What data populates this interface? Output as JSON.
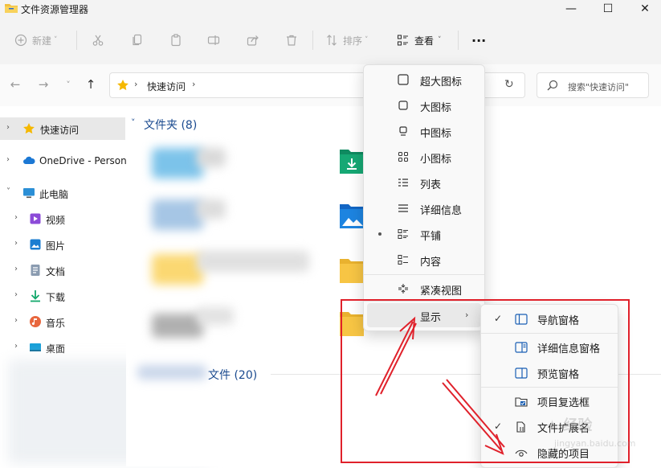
{
  "window": {
    "title": "文件资源管理器",
    "min_glyph": "—",
    "max_glyph": "☐",
    "close_glyph": "✕"
  },
  "toolbar": {
    "new_label": "新建",
    "sort_label": "排序",
    "view_label": "查看",
    "more_glyph": "···"
  },
  "nav": {
    "back_glyph": "←",
    "forward_glyph": "→",
    "recent_glyph": "˅",
    "up_glyph": "↑",
    "breadcrumb": "快速访问",
    "sep_glyph": "›",
    "refresh_glyph": "↻",
    "search_placeholder": "搜索\"快速访问\""
  },
  "sidebar": {
    "items": [
      {
        "label": "快速访问",
        "icon": "star-icon"
      },
      {
        "label": "OneDrive - Person",
        "icon": "cloud-icon"
      },
      {
        "label": "此电脑",
        "icon": "computer-icon"
      },
      {
        "label": "视频",
        "icon": "video-icon"
      },
      {
        "label": "图片",
        "icon": "picture-icon"
      },
      {
        "label": "文档",
        "icon": "document-icon"
      },
      {
        "label": "下载",
        "icon": "download-icon"
      },
      {
        "label": "音乐",
        "icon": "music-icon"
      },
      {
        "label": "桌面",
        "icon": "desktop-icon"
      }
    ],
    "chev_right": "›",
    "chev_down": "˅"
  },
  "content": {
    "folders_header": "文件夹 (8)",
    "files_header": "文件 (20)",
    "chev_down": "˅"
  },
  "view_menu": {
    "items": [
      {
        "label": "超大图标",
        "icon": "extra-large-icons-icon"
      },
      {
        "label": "大图标",
        "icon": "large-icons-icon"
      },
      {
        "label": "中图标",
        "icon": "medium-icons-icon"
      },
      {
        "label": "小图标",
        "icon": "small-icons-icon"
      },
      {
        "label": "列表",
        "icon": "list-icon"
      },
      {
        "label": "详细信息",
        "icon": "details-icon"
      },
      {
        "label": "平铺",
        "icon": "tiles-icon",
        "selected": true
      },
      {
        "label": "内容",
        "icon": "content-icon"
      },
      {
        "label": "紧凑视图",
        "icon": "compact-view-icon"
      },
      {
        "label": "显示",
        "icon": "",
        "has_submenu": true
      }
    ],
    "sub_arrow": "›"
  },
  "show_submenu": {
    "items": [
      {
        "label": "导航窗格",
        "checked": true
      },
      {
        "label": "详细信息窗格",
        "checked": false
      },
      {
        "label": "预览窗格",
        "checked": false
      },
      {
        "label": "项目复选框",
        "checked": false
      },
      {
        "label": "文件扩展名",
        "checked": true
      },
      {
        "label": "隐藏的项目",
        "checked": false
      }
    ],
    "check_glyph": "✓"
  },
  "colors": {
    "accent": "#1a4a8f",
    "annotation": "#e0212b",
    "folder": "#f7c544"
  }
}
